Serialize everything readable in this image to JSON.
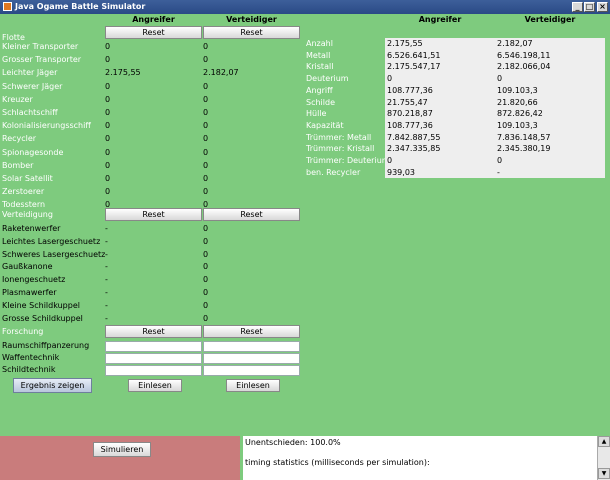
{
  "window": {
    "title": "Java Ogame Battle Simulator"
  },
  "headers": {
    "attacker": "Angreifer",
    "defender": "Verteidiger"
  },
  "reset_label": "Reset",
  "sections": {
    "fleet": "Flotte",
    "defense": "Verteidigung",
    "research": "Forschung"
  },
  "fleet": [
    {
      "name": "Kleiner Transporter",
      "att": "0",
      "def": "0"
    },
    {
      "name": "Grosser Transporter",
      "att": "0",
      "def": "0"
    },
    {
      "name": "Leichter Jäger",
      "att": "2.175,55",
      "def": "2.182,07"
    },
    {
      "name": "Schwerer Jäger",
      "att": "0",
      "def": "0"
    },
    {
      "name": "Kreuzer",
      "att": "0",
      "def": "0"
    },
    {
      "name": "Schlachtschiff",
      "att": "0",
      "def": "0"
    },
    {
      "name": "Kolonialisierungsschiff",
      "att": "0",
      "def": "0"
    },
    {
      "name": "Recycler",
      "att": "0",
      "def": "0"
    },
    {
      "name": "Spionagesonde",
      "att": "0",
      "def": "0"
    },
    {
      "name": "Bomber",
      "att": "0",
      "def": "0"
    },
    {
      "name": "Solar Satellit",
      "att": "0",
      "def": "0"
    },
    {
      "name": "Zerstoerer",
      "att": "0",
      "def": "0"
    },
    {
      "name": "Todesstern",
      "att": "0",
      "def": "0"
    }
  ],
  "defense": [
    {
      "name": "Raketenwerfer",
      "att": "-",
      "def": "0"
    },
    {
      "name": "Leichtes Lasergeschuetz",
      "att": "-",
      "def": "0"
    },
    {
      "name": "Schweres Lasergeschuetz",
      "att": "-",
      "def": "0"
    },
    {
      "name": "Gaußkanone",
      "att": "-",
      "def": "0"
    },
    {
      "name": "Ionengeschuetz",
      "att": "-",
      "def": "0"
    },
    {
      "name": "Plasmawerfer",
      "att": "-",
      "def": "0"
    },
    {
      "name": "Kleine Schildkuppel",
      "att": "-",
      "def": "0"
    },
    {
      "name": "Grosse Schildkuppel",
      "att": "-",
      "def": "0"
    }
  ],
  "research": [
    {
      "name": "Raumschiffpanzerung"
    },
    {
      "name": "Waffentechnik"
    },
    {
      "name": "Schildtechnik"
    }
  ],
  "buttons": {
    "show_result": "Ergebnis zeigen",
    "read_att": "Einlesen",
    "read_def": "Einlesen",
    "simulate": "Simulieren"
  },
  "results": [
    {
      "label": "Anzahl",
      "att": "2.175,55",
      "def": "2.182,07"
    },
    {
      "label": "Metall",
      "att": "6.526.641,51",
      "def": "6.546.198,11"
    },
    {
      "label": "Kristall",
      "att": "2.175.547,17",
      "def": "2.182.066,04"
    },
    {
      "label": "Deuterium",
      "att": "0",
      "def": "0"
    },
    {
      "label": "Angriff",
      "att": "108.777,36",
      "def": "109.103,3"
    },
    {
      "label": "Schilde",
      "att": "21.755,47",
      "def": "21.820,66"
    },
    {
      "label": "Hülle",
      "att": "870.218,87",
      "def": "872.826,42"
    },
    {
      "label": "Kapazität",
      "att": "108.777,36",
      "def": "109.103,3"
    },
    {
      "label": "Trümmer: Metall",
      "att": "7.842.887,55",
      "def": "7.836.148,57"
    },
    {
      "label": "Trümmer: Kristall",
      "att": "2.347.335,85",
      "def": "2.345.380,19"
    },
    {
      "label": "Trümmer: Deuterium",
      "att": "0",
      "def": "0"
    },
    {
      "label": "ben. Recycler",
      "att": "939,03",
      "def": "-"
    }
  ],
  "output": {
    "line1": "Unentschieden: 100.0%",
    "line2": "timing statistics (milliseconds per simulation):"
  },
  "colors": {
    "background": "#7ecb7e",
    "red_panel": "#c97c7c",
    "titlebar": "#2a4a86"
  }
}
